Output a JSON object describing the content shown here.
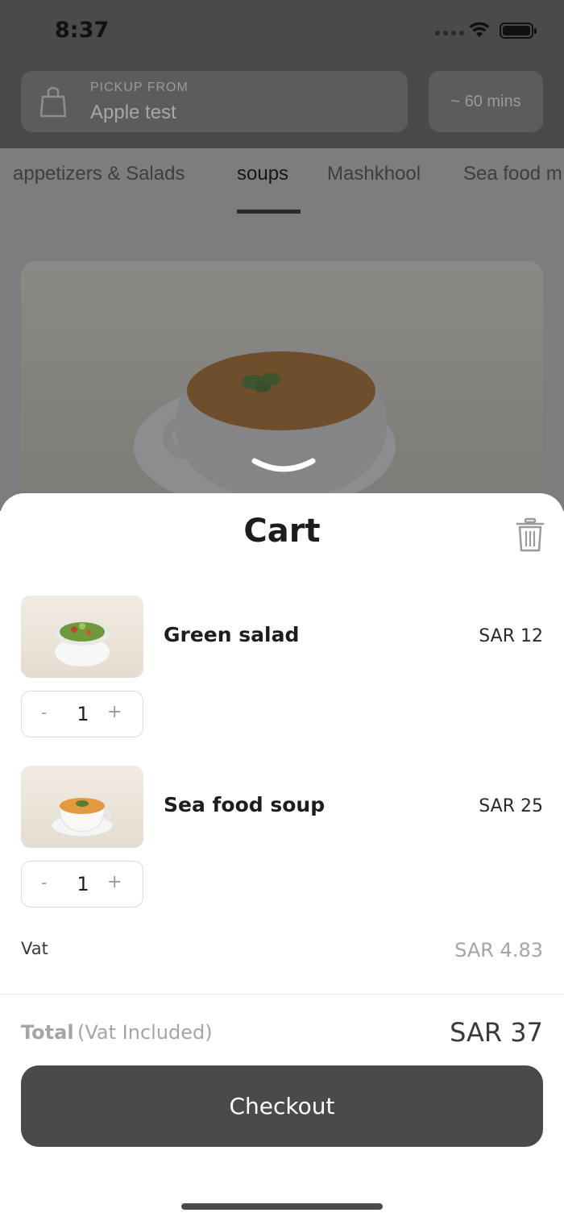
{
  "status_bar": {
    "time": "8:37"
  },
  "header": {
    "pickup_caption": "PICKUP FROM",
    "pickup_name": "Apple test",
    "eta": "~ 60 mins"
  },
  "tabs": [
    {
      "label": "appetizers &  Salads",
      "active": false
    },
    {
      "label": "soups",
      "active": true
    },
    {
      "label": "Mashkhool",
      "active": false
    },
    {
      "label": "Sea food m",
      "active": false
    }
  ],
  "cart": {
    "title": "Cart",
    "items": [
      {
        "name": "Green salad",
        "price": "SAR 12",
        "quantity": "1",
        "minus": "-",
        "plus": "+"
      },
      {
        "name": "Sea food soup",
        "price": "SAR 25",
        "quantity": "1",
        "minus": "-",
        "plus": "+"
      }
    ],
    "vat_label": "Vat",
    "vat_value": "SAR 4.83",
    "total_label": "Total",
    "total_note": "(Vat Included)",
    "total_value": "SAR 37",
    "checkout_label": "Checkout"
  },
  "colors": {
    "accent_dark": "#4a494c",
    "muted_text": "#a5a5a5"
  }
}
